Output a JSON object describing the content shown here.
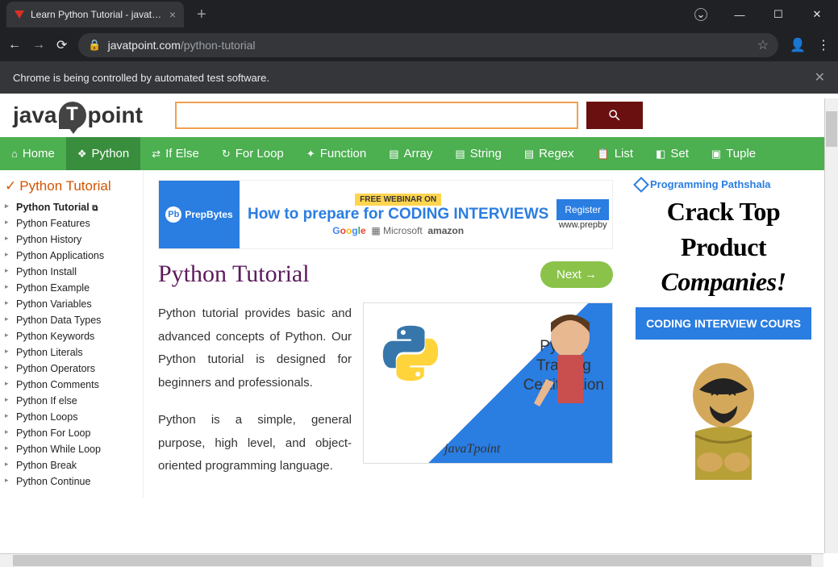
{
  "browser": {
    "tab_title": "Learn Python Tutorial - javatpoin",
    "url_host": "javatpoint.com",
    "url_path": "/python-tutorial",
    "infobar": "Chrome is being controlled by automated test software."
  },
  "nav": {
    "items": [
      {
        "label": "Home"
      },
      {
        "label": "Python"
      },
      {
        "label": "If Else"
      },
      {
        "label": "For Loop"
      },
      {
        "label": "Function"
      },
      {
        "label": "Array"
      },
      {
        "label": "String"
      },
      {
        "label": "Regex"
      },
      {
        "label": "List"
      },
      {
        "label": "Set"
      },
      {
        "label": "Tuple"
      }
    ]
  },
  "sidebar": {
    "heading": "Python Tutorial",
    "items": [
      "Python Tutorial",
      "Python Features",
      "Python History",
      "Python Applications",
      "Python Install",
      "Python Example",
      "Python Variables",
      "Python Data Types",
      "Python Keywords",
      "Python Literals",
      "Python Operators",
      "Python Comments",
      "Python If else",
      "Python Loops",
      "Python For Loop",
      "Python While Loop",
      "Python Break",
      "Python Continue"
    ]
  },
  "ad": {
    "prepbytes": "PrepBytes",
    "free": "FREE WEBINAR ON",
    "headline_pre": "How to prepare for ",
    "headline_bold": "CODING INTERVIEWS",
    "brand_ms": "Microsoft",
    "brand_amz": "amazon",
    "register": "Register",
    "url": "www.prepby"
  },
  "content": {
    "title": "Python Tutorial",
    "next": "Next →",
    "p1": "Python tutorial provides basic and advanced concepts of Python. Our Python tutorial is designed for beginners and professionals.",
    "p2": "Python is a simple, general purpose, high level, and object-oriented programming language.",
    "img_line1": "Python",
    "img_line2": "Training",
    "img_line3": "Certification",
    "img_brand": "javaTpoint"
  },
  "right": {
    "brand": "Programming Pathshala",
    "h1": "Crack Top",
    "h2": "Product",
    "h3": "Companies!",
    "cta": "CODING INTERVIEW COURS"
  }
}
